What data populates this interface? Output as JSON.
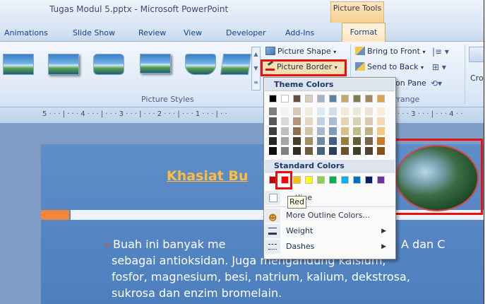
{
  "window": {
    "title": "Tugas Modul 5.pptx - Microsoft PowerPoint",
    "context_tab_group": "Picture Tools"
  },
  "tabs": [
    "Animations",
    "Slide Show",
    "Review",
    "View",
    "Developer",
    "Add-Ins",
    "Format"
  ],
  "ribbon": {
    "picture_shape": "Picture Shape",
    "picture_border": "Picture Border",
    "bring_to_front": "Bring to Front",
    "send_to_back": "Send to Back",
    "selection_pane": "on Pane",
    "crop": "Cro",
    "group_picture_styles": "Picture Styles",
    "group_arrange": "rrange"
  },
  "ruler": "5 · · · | · · · 4 · · · | · · · 3 · · · | · · · 2 · · · | · · · 1 · · · | · ·",
  "ruler_right": "· · · 3 · · · | · · · 4 · ·",
  "dropdown": {
    "theme_colors_label": "Theme Colors",
    "standard_colors_label": "Standard Colors",
    "no_outline": "utline",
    "more_outline_colors": "More Outline Colors...",
    "weight": "Weight",
    "dashes": "Dashes",
    "tooltip": "Red",
    "theme_top_row": [
      "#000000",
      "#ffffff",
      "#5f4f3c",
      "#d9cfb8",
      "#9fb5c7",
      "#5c7fa6",
      "#c4a96a",
      "#7f7f4a",
      "#9e8a5c",
      "#e1a24f"
    ],
    "theme_shades": [
      [
        "#7f7f7f",
        "#f2f2f2",
        "#d8cab7",
        "#f1ebde",
        "#dfe7ef",
        "#d3dde9",
        "#f2ead7",
        "#e9e9d7",
        "#ebe4d6",
        "#fbecd8"
      ],
      [
        "#595959",
        "#d9d9d9",
        "#b3967a",
        "#e2d8c0",
        "#c3d0dd",
        "#a9bcd4",
        "#e4d4b0",
        "#d3d3ae",
        "#d6c9ac",
        "#f6d9b1"
      ],
      [
        "#3f3f3f",
        "#bfbfbf",
        "#8e6f52",
        "#d2c3a3",
        "#a7b8ca",
        "#7f9abe",
        "#d7bf89",
        "#bdbd86",
        "#c2ae83",
        "#f1c78a"
      ],
      [
        "#262626",
        "#a5a5a5",
        "#4a3c2d",
        "#a08d63",
        "#6c8aa3",
        "#415f85",
        "#9f7d3e",
        "#5f5f37",
        "#766545",
        "#c57c25"
      ],
      [
        "#0c0c0c",
        "#7f7f7f",
        "#312820",
        "#6b5d42",
        "#48627a",
        "#2b3f59",
        "#6a532a",
        "#3f3f25",
        "#4f432e",
        "#83521a"
      ]
    ],
    "standard": [
      "#c00000",
      "#ff0000",
      "#ffc000",
      "#ffff00",
      "#92d050",
      "#00b050",
      "#00b0f0",
      "#0070c0",
      "#002060",
      "#7030a0"
    ]
  },
  "slide": {
    "title": "Khasiat Bu",
    "line1_left": "Buah  ini  banyak  me",
    "line1_right": "A  dan  C",
    "line2": "sebagai  antioksidan.  Juga  mengandung  kalsium,",
    "line3": "fosfor, magnesium, besi, natrium, kalium, dekstrosa,",
    "line4": "sukrosa dan enzim bromelain."
  }
}
